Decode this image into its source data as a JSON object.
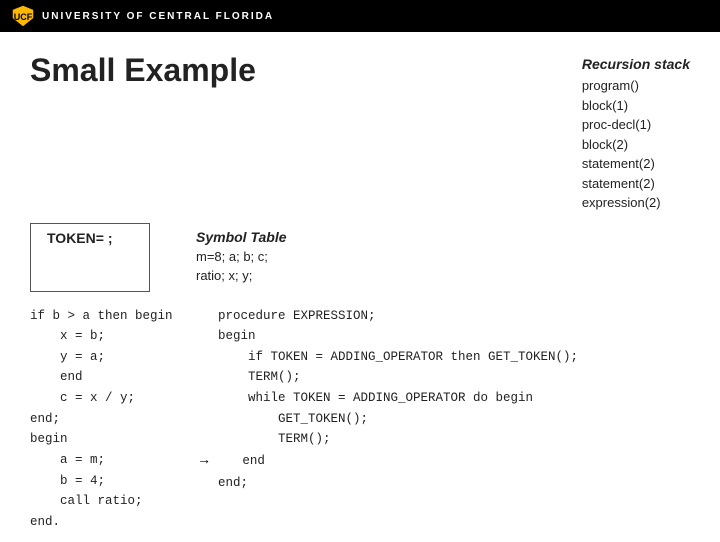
{
  "header": {
    "university_text": "UNIVERSITY OF CENTRAL FLORIDA"
  },
  "page": {
    "title": "Small Example"
  },
  "token_box": {
    "label": "TOKEN= ;"
  },
  "symbol_table": {
    "title": "Symbol Table",
    "content_line1": "m=8; a; b; c;",
    "content_line2": "ratio; x; y;"
  },
  "recursion_stack": {
    "title": "Recursion stack",
    "items": [
      "program()",
      "block(1)",
      "proc-decl(1)",
      "block(2)",
      "statement(2)",
      "statement(2)",
      "expression(2)"
    ]
  },
  "left_code": {
    "lines": [
      "if b > a then begin",
      "    x = b;",
      "    y = a;",
      "    end",
      "    c = x / y;",
      "end;",
      "begin",
      "    a = m;",
      "    b = 4;",
      "    call ratio;",
      "end."
    ]
  },
  "right_code": {
    "lines": [
      "procedure EXPRESSION;",
      "begin",
      "    if TOKEN = ADDING_OPERATOR then GET_TOKEN();",
      "    TERM();",
      "    while TOKEN = ADDING_OPERATOR do begin",
      "        GET_TOKEN();",
      "        TERM();",
      "    end",
      "end;"
    ],
    "arrow_line": 7
  }
}
